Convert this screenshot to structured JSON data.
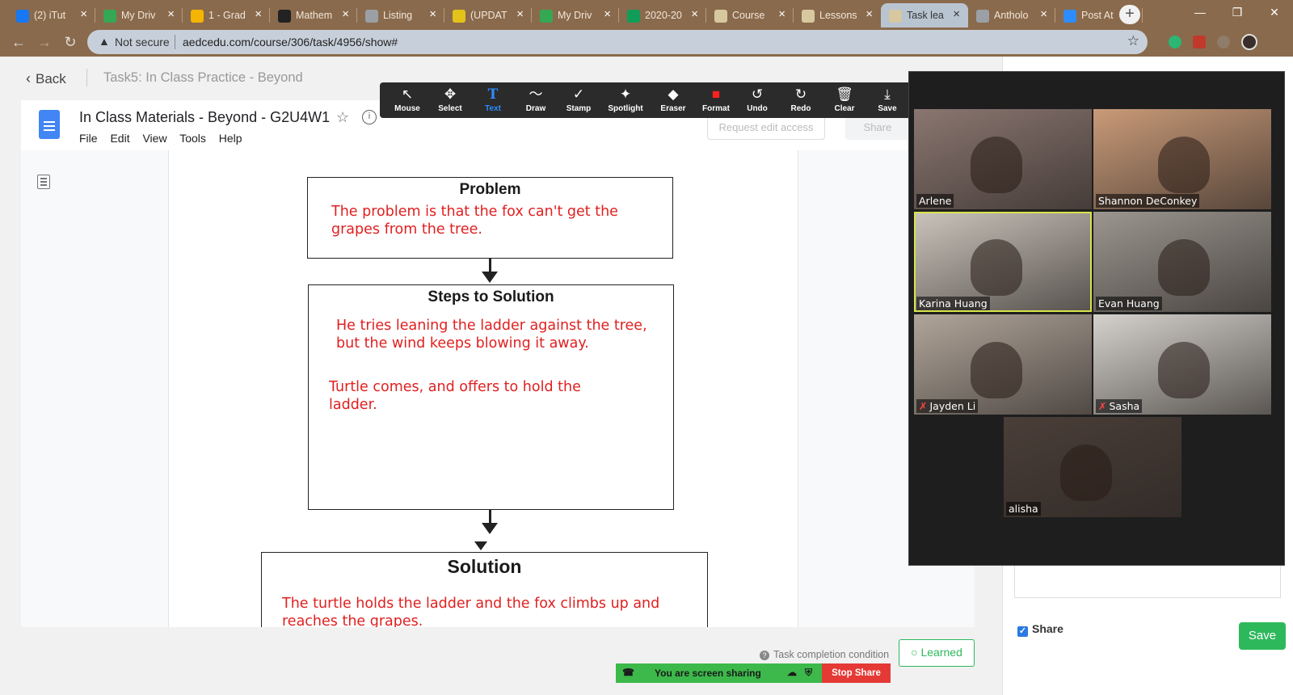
{
  "browser": {
    "tabs": [
      {
        "title": "(2) iTut",
        "color": "#1877f2"
      },
      {
        "title": "My Driv",
        "color": "#34a853"
      },
      {
        "title": "1 - Grad",
        "color": "#f4b400"
      },
      {
        "title": "Mathem",
        "color": "#222222"
      },
      {
        "title": "Listing",
        "color": "#9aa0a6"
      },
      {
        "title": "(UPDAT",
        "color": "#e3c21a"
      },
      {
        "title": "My Driv",
        "color": "#34a853"
      },
      {
        "title": "2020-20",
        "color": "#0f9d58"
      },
      {
        "title": "Course",
        "color": "#d7c8a0"
      },
      {
        "title": "Lessons",
        "color": "#d7c8a0"
      },
      {
        "title": "Task lea",
        "color": "#d7c8a0"
      },
      {
        "title": "Antholo",
        "color": "#9aa0a6"
      },
      {
        "title": "Post At",
        "color": "#2d8cff"
      }
    ],
    "close_glyph": "×",
    "new_tab": "+",
    "window_controls": [
      "—",
      "❐",
      "✕"
    ],
    "nav": {
      "back": "←",
      "forward": "→",
      "reload": "↻"
    },
    "address": {
      "warning_icon": "▲",
      "security_label": "Not secure",
      "url": "aedcedu.com/course/306/task/4956/show#",
      "bookmark_icon": "☆"
    }
  },
  "header": {
    "back_label": "Back",
    "back_icon": "‹",
    "task_title": "Task5:  In Class Practice - Beyond"
  },
  "doc": {
    "title": "In Class Materials - Beyond - G2U4W1",
    "star_icon": "☆",
    "info_icon": "i",
    "menus": [
      "File",
      "Edit",
      "View",
      "Tools",
      "Help"
    ],
    "request_edit_label": "Request edit access",
    "share_label": "Share",
    "boxes": {
      "problem": {
        "title": "Problem",
        "text": [
          "The problem is that the fox can't get the",
          "grapes from the tree."
        ]
      },
      "steps": {
        "title": "Steps to Solution",
        "text1": [
          "He tries leaning the ladder against the tree,",
          "but the wind keeps blowing it away."
        ],
        "text2": [
          "Turtle comes, and offers to hold the",
          "ladder."
        ]
      },
      "solution": {
        "title": "Solution",
        "text": [
          "The turtle holds the ladder and the fox climbs up and",
          "reaches the grapes."
        ]
      }
    }
  },
  "zoom_toolbar": {
    "tools": [
      {
        "label": "Mouse",
        "icon": "↖"
      },
      {
        "label": "Select",
        "icon": "✥"
      },
      {
        "label": "Text",
        "icon": "T"
      },
      {
        "label": "Draw",
        "icon": "〜"
      },
      {
        "label": "Stamp",
        "icon": "✓"
      },
      {
        "label": "Spotlight",
        "icon": "✦"
      },
      {
        "label": "Eraser",
        "icon": "◆"
      },
      {
        "label": "Format",
        "icon": "■"
      },
      {
        "label": "Undo",
        "icon": "↺"
      },
      {
        "label": "Redo",
        "icon": "↻"
      },
      {
        "label": "Clear",
        "icon": "🗑"
      },
      {
        "label": "Save",
        "icon": "⤓"
      }
    ],
    "text_color": "#2d8cff",
    "format_color": "#ff2020",
    "close_icon": "✕"
  },
  "gallery": {
    "participants": [
      {
        "name": "Arlene",
        "muted": false,
        "active": false,
        "bg": "#8a7670"
      },
      {
        "name": "Shannon DeConkey",
        "muted": false,
        "active": false,
        "bg": "#c99a78"
      },
      {
        "name": "Karina Huang",
        "muted": false,
        "active": true,
        "bg": "#cbc4bc"
      },
      {
        "name": "Evan Huang",
        "muted": false,
        "active": false,
        "bg": "#9b968f"
      },
      {
        "name": "Jayden Li",
        "muted": true,
        "active": false,
        "bg": "#b0a59a"
      },
      {
        "name": "Sasha",
        "muted": true,
        "active": false,
        "bg": "#d5d2cd"
      },
      {
        "name": "alisha",
        "muted": false,
        "active": false,
        "bg": "#4a3e38"
      }
    ],
    "muted_icon": "✗"
  },
  "side": {
    "share_label": "Share",
    "share_checked": true,
    "save_label": "Save",
    "check_icon": "✓"
  },
  "footer": {
    "help_icon": "?",
    "task_condition": "Task completion condition",
    "learned_label": "Learned",
    "learned_icon": "○",
    "screen_sharing": "You are screen sharing",
    "stop_share": "Stop Share"
  }
}
